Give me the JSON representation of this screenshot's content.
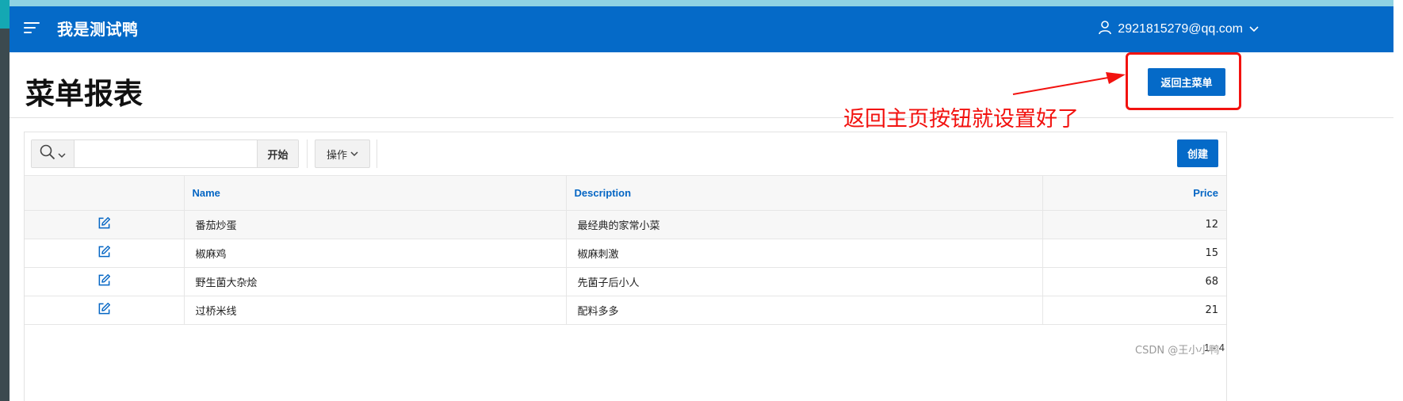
{
  "header": {
    "app_title": "我是测试鸭",
    "user_email": "2921815279@qq.com"
  },
  "page": {
    "title": "菜单报表",
    "back_button_label": "返回主菜单"
  },
  "annotation": {
    "text": "返回主页按钮就设置好了",
    "color": "#f2120f"
  },
  "toolbar": {
    "search_placeholder": "",
    "search_value": "",
    "go_label": "开始",
    "actions_label": "操作",
    "create_label": "创建"
  },
  "table": {
    "columns": [
      "Name",
      "Description",
      "Price"
    ],
    "rows": [
      {
        "name": "番茄炒蛋",
        "description": "最经典的家常小菜",
        "price": "12"
      },
      {
        "name": "椒麻鸡",
        "description": "椒麻刺激",
        "price": "15"
      },
      {
        "name": "野生菌大杂烩",
        "description": "先菌子后小人",
        "price": "68"
      },
      {
        "name": "过桥米线",
        "description": "配料多多",
        "price": "21"
      }
    ]
  },
  "pagination": "1 - 4",
  "watermark": "CSDN @王小小鸭",
  "colors": {
    "brand": "#056ac8",
    "link": "#0566c4"
  }
}
